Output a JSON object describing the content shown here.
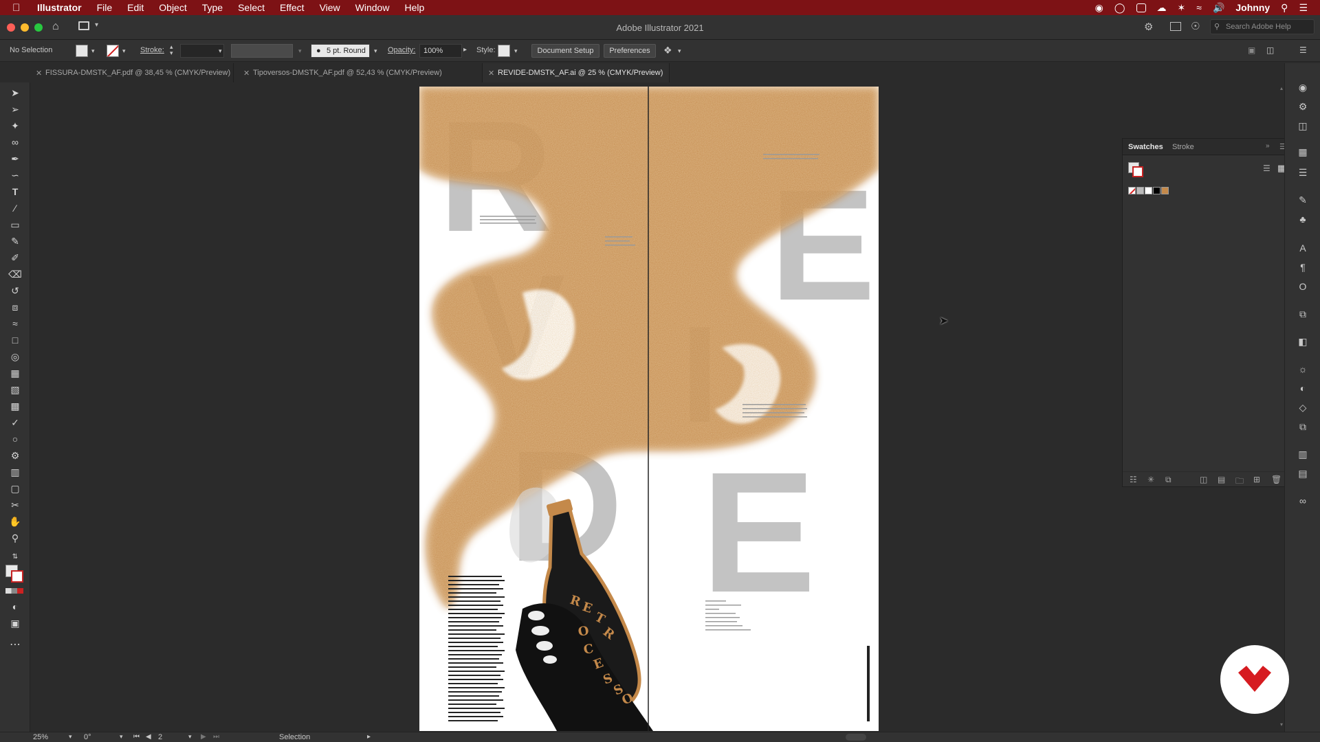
{
  "menubar": {
    "app": "Illustrator",
    "items": [
      "File",
      "Edit",
      "Object",
      "Type",
      "Select",
      "Effect",
      "View",
      "Window",
      "Help"
    ],
    "user": "Johnny"
  },
  "titlebar": {
    "title": "Adobe Illustrator 2021",
    "search_placeholder": "Search Adobe Help"
  },
  "control": {
    "selection": "No Selection",
    "stroke_label": "Stroke:",
    "brush": "5 pt. Round",
    "opacity_label": "Opacity:",
    "opacity_value": "100%",
    "style_label": "Style:",
    "document_setup": "Document Setup",
    "preferences": "Preferences"
  },
  "tabs": [
    {
      "label": "FISSURA-DMSTK_AF.pdf @ 38,45 % (CMYK/Preview)",
      "active": false
    },
    {
      "label": "Tipoversos-DMSTK_AF.pdf @ 52,43 % (CMYK/Preview)",
      "active": false
    },
    {
      "label": "REVIDE-DMSTK_AF.ai @ 25 % (CMYK/Preview)",
      "active": true
    }
  ],
  "panel": {
    "tab_swatches": "Swatches",
    "tab_stroke": "Stroke"
  },
  "artwork": {
    "letters_left": [
      "R",
      "V",
      "D"
    ],
    "letters_right": [
      "E",
      "I",
      "E"
    ],
    "bottle_text": [
      "R",
      "E",
      "T",
      "R",
      "O",
      "C",
      "E",
      "S",
      "S",
      "O"
    ]
  },
  "status": {
    "zoom": "25%",
    "rotation": "0°",
    "page": "2",
    "tool": "Selection"
  },
  "colors": {
    "menubar": "#7d1215",
    "smoke": "#c4894a",
    "letters": "#c3c3c3",
    "logo_red": "#d61b20"
  }
}
